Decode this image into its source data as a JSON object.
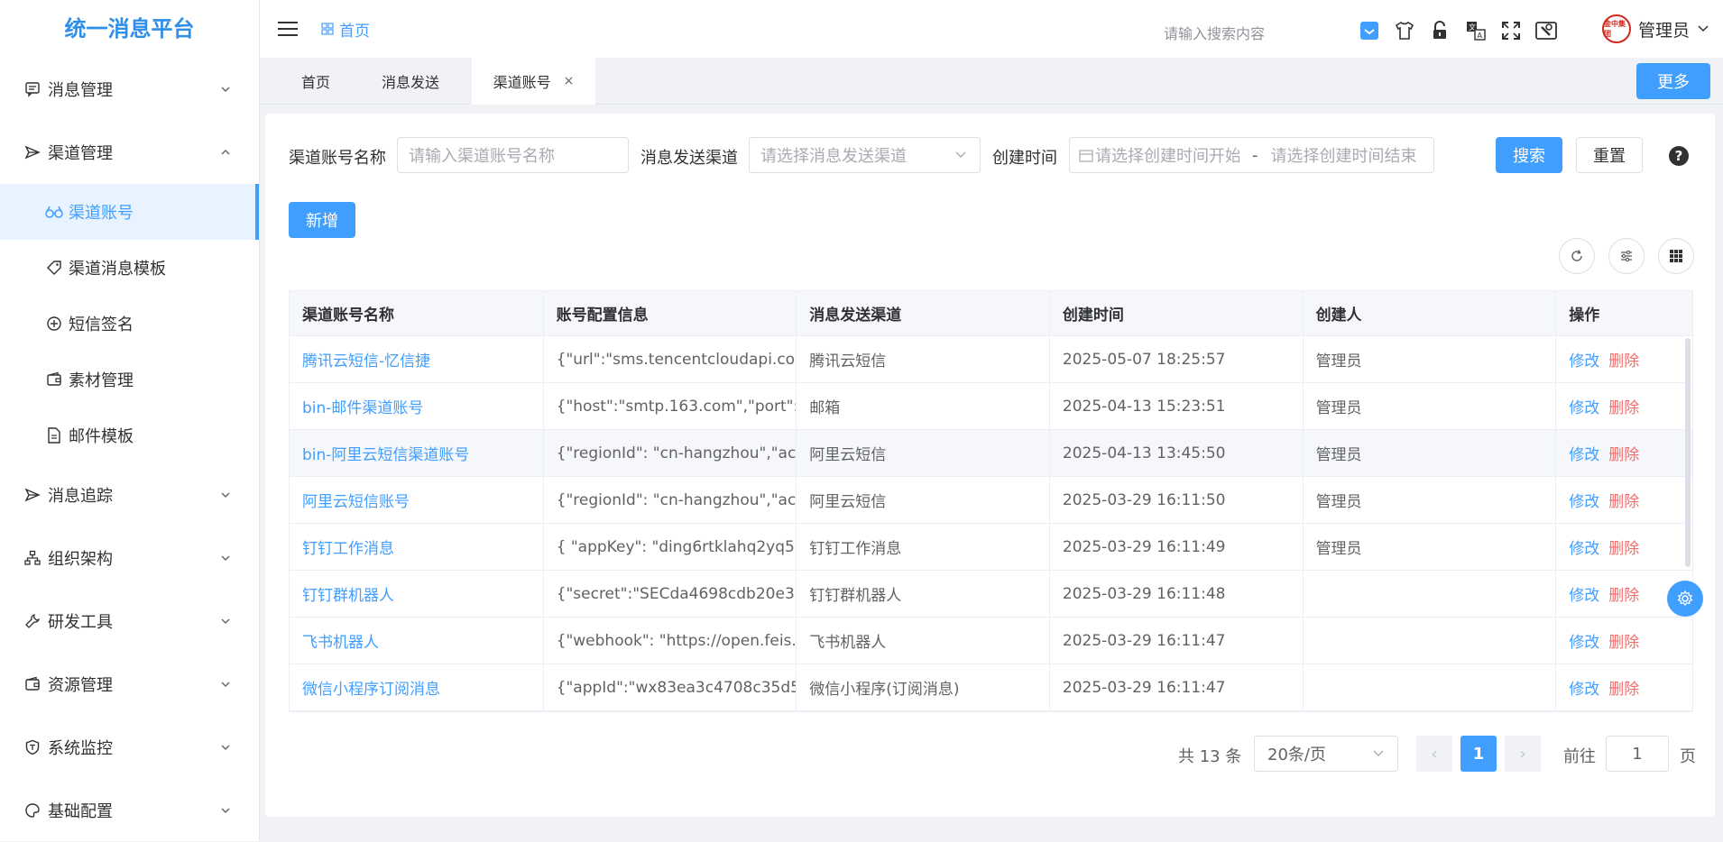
{
  "app": {
    "title": "统一消息平台"
  },
  "sidebar": {
    "items": [
      {
        "label": "消息管理",
        "icon": "message-icon"
      },
      {
        "label": "渠道管理",
        "icon": "send-icon"
      },
      {
        "label": "消息追踪",
        "icon": "send-icon"
      },
      {
        "label": "组织架构",
        "icon": "org-icon"
      },
      {
        "label": "研发工具",
        "icon": "wrench-icon"
      },
      {
        "label": "资源管理",
        "icon": "wallet-icon"
      },
      {
        "label": "系统监控",
        "icon": "shield-icon"
      },
      {
        "label": "基础配置",
        "icon": "palette-icon"
      }
    ],
    "sub_items": [
      {
        "label": "渠道账号",
        "icon": "glasses-icon"
      },
      {
        "label": "渠道消息模板",
        "icon": "tag-icon"
      },
      {
        "label": "短信签名",
        "icon": "plus-circle-icon"
      },
      {
        "label": "素材管理",
        "icon": "wallet-icon"
      },
      {
        "label": "邮件模板",
        "icon": "document-icon"
      }
    ]
  },
  "header": {
    "breadcrumb": "首页",
    "search_placeholder": "请输入搜索内容",
    "user_name": "管理员",
    "avatar_text": "金中集团"
  },
  "tabs": {
    "items": [
      "首页",
      "消息发送",
      "渠道账号"
    ],
    "close": "×",
    "more_label": "更多"
  },
  "filters": {
    "name_label": "渠道账号名称",
    "name_placeholder": "请输入渠道账号名称",
    "channel_label": "消息发送渠道",
    "channel_placeholder": "请选择消息发送渠道",
    "time_label": "创建时间",
    "time_start_placeholder": "请选择创建时间开始",
    "time_sep": "-",
    "time_end_placeholder": "请选择创建时间结束",
    "search_label": "搜索",
    "reset_label": "重置",
    "help": "?"
  },
  "actions": {
    "add_label": "新增"
  },
  "table": {
    "columns": [
      "渠道账号名称",
      "账号配置信息",
      "消息发送渠道",
      "创建时间",
      "创建人",
      "操作"
    ],
    "edit_label": "修改",
    "delete_label": "删除",
    "rows": [
      {
        "name": "腾讯云短信-忆信捷",
        "config": "{\"url\":\"sms.tencentcloudapi.co...",
        "channel": "腾讯云短信",
        "created": "2025-05-07 18:25:57",
        "creator": "管理员"
      },
      {
        "name": "bin-邮件渠道账号",
        "config": "{\"host\":\"smtp.163.com\",\"port\":...",
        "channel": "邮箱",
        "created": "2025-04-13 15:23:51",
        "creator": "管理员"
      },
      {
        "name": "bin-阿里云短信渠道账号",
        "config": "{\"regionId\": \"cn-hangzhou\",\"ac...",
        "channel": "阿里云短信",
        "created": "2025-04-13 13:45:50",
        "creator": "管理员"
      },
      {
        "name": "阿里云短信账号",
        "config": "{\"regionId\": \"cn-hangzhou\",\"ac...",
        "channel": "阿里云短信",
        "created": "2025-03-29 16:11:50",
        "creator": "管理员"
      },
      {
        "name": "钉钉工作消息",
        "config": "{ \"appKey\": \"ding6rtklahq2yq5...",
        "channel": "钉钉工作消息",
        "created": "2025-03-29 16:11:49",
        "creator": "管理员"
      },
      {
        "name": "钉钉群机器人",
        "config": "{\"secret\":\"SECda4698cdb20e3...",
        "channel": "钉钉群机器人",
        "created": "2025-03-29 16:11:48",
        "creator": ""
      },
      {
        "name": "飞书机器人",
        "config": "{\"webhook\": \"https://open.feis...",
        "channel": "飞书机器人",
        "created": "2025-03-29 16:11:47",
        "creator": ""
      },
      {
        "name": "微信小程序订阅消息",
        "config": "{\"appId\":\"wx83ea3c4708c35d5...",
        "channel": "微信小程序(订阅消息)",
        "created": "2025-03-29 16:11:47",
        "creator": ""
      }
    ]
  },
  "pagination": {
    "total": "共 13 条",
    "page_size": "20条/页",
    "current": "1",
    "prev": "‹",
    "next": "›",
    "goto_label": "前往",
    "goto_value": "1",
    "page_suffix": "页"
  },
  "colors": {
    "accent": "#409eff",
    "danger": "#f56c6c",
    "brand": "#2f8ee8"
  }
}
